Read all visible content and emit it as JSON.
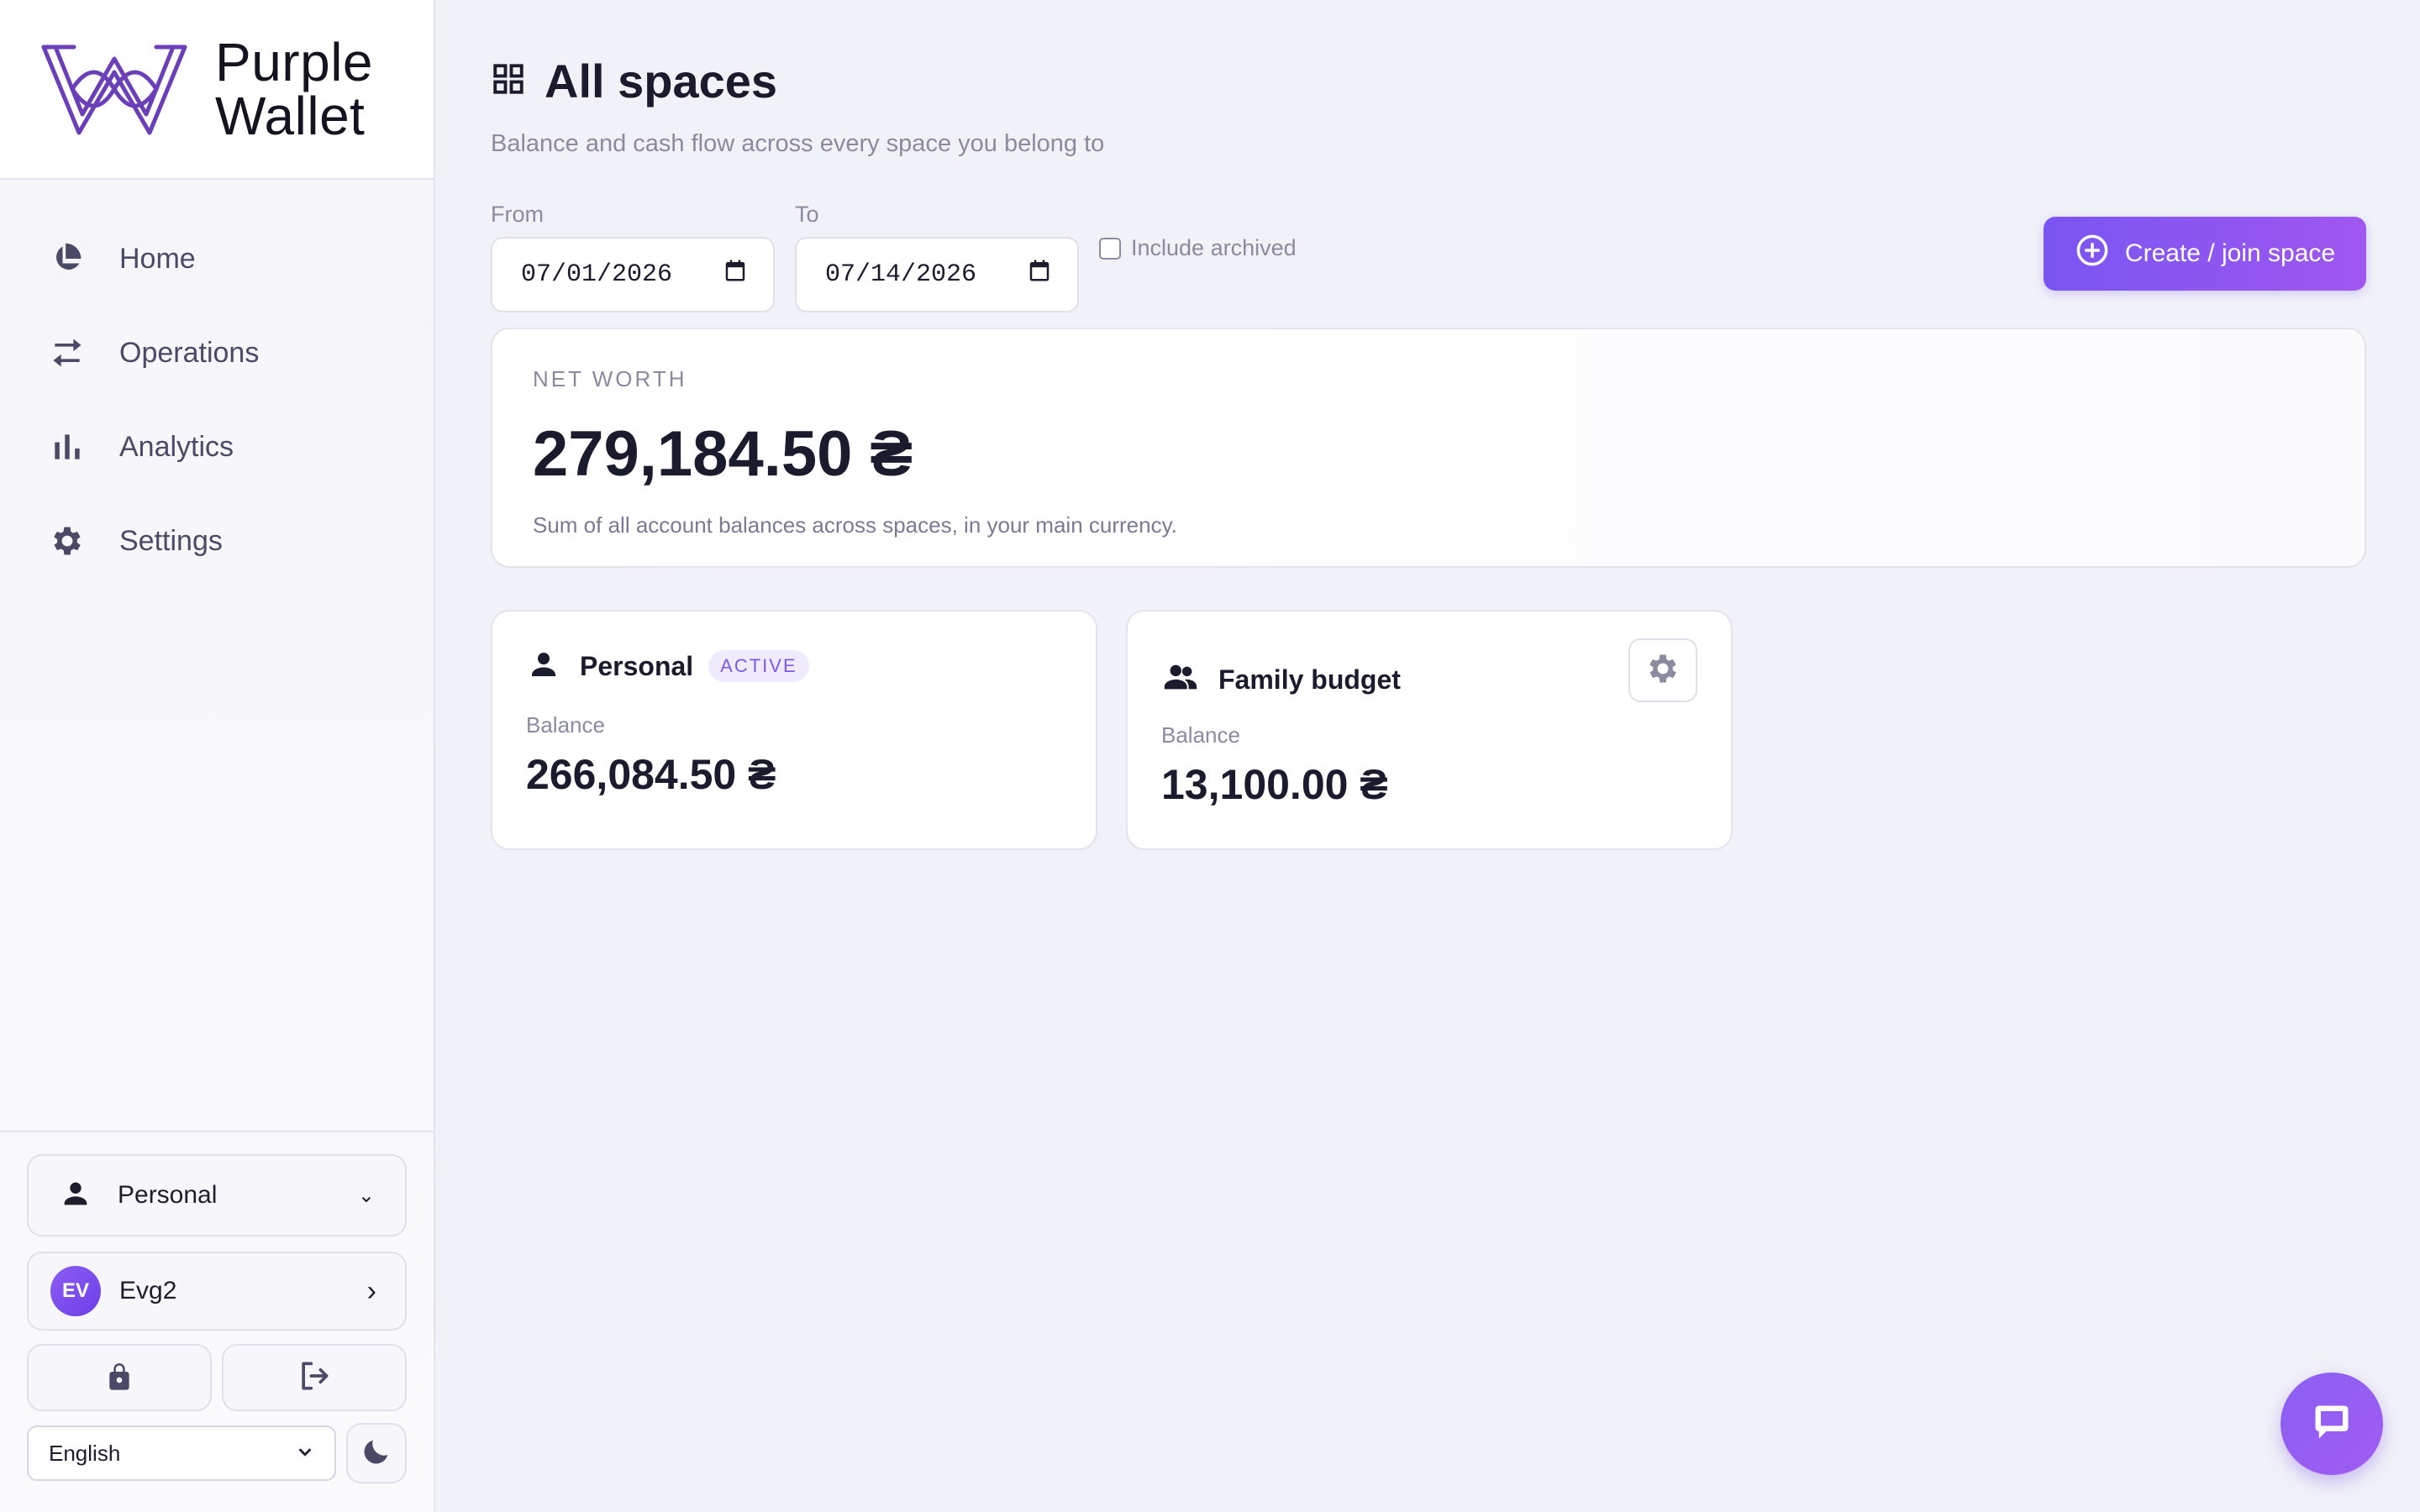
{
  "brand": {
    "line1": "Purple",
    "line2": "Wallet",
    "accent": "#6a3fb8"
  },
  "nav": {
    "items": [
      {
        "label": "Home",
        "icon": "pie-chart-icon"
      },
      {
        "label": "Operations",
        "icon": "arrows-swap-icon"
      },
      {
        "label": "Analytics",
        "icon": "bar-chart-icon"
      },
      {
        "label": "Settings",
        "icon": "gear-icon"
      }
    ]
  },
  "sidebar_bottom": {
    "space_switcher": {
      "label": "Personal",
      "icon": "person-icon",
      "chevron": "⌄"
    },
    "user": {
      "initials": "EV",
      "name": "Evg2",
      "chevron": "›"
    },
    "lock_icon": "lock-icon",
    "logout_icon": "logout-icon",
    "language": {
      "selected": "English"
    },
    "theme_icon": "moon-icon"
  },
  "page": {
    "title": "All spaces",
    "subtitle": "Balance and cash flow across every space you belong to",
    "title_icon": "grid-icon"
  },
  "filters": {
    "from_label": "From",
    "from_value": "07/01/2026",
    "to_label": "To",
    "to_value": "07/14/2026",
    "include_archived_label": "Include archived",
    "include_archived_checked": false
  },
  "actions": {
    "create_join_label": "Create / join space"
  },
  "net_worth": {
    "label": "NET WORTH",
    "value": "279,184.50 ₴",
    "note": "Sum of all account balances across spaces, in your main currency."
  },
  "spaces": [
    {
      "name": "Personal",
      "badge": "ACTIVE",
      "balance_label": "Balance",
      "balance": "266,084.50 ₴",
      "icon": "person-icon"
    },
    {
      "name": "Family budget",
      "balance_label": "Balance",
      "balance": "13,100.00 ₴",
      "icon": "group-icon"
    }
  ],
  "colors": {
    "primary": "#7a55f2",
    "primary_end": "#a057f0",
    "text": "#1b1b2e",
    "muted": "#8a8aa0",
    "background": "#f1f2f8"
  }
}
